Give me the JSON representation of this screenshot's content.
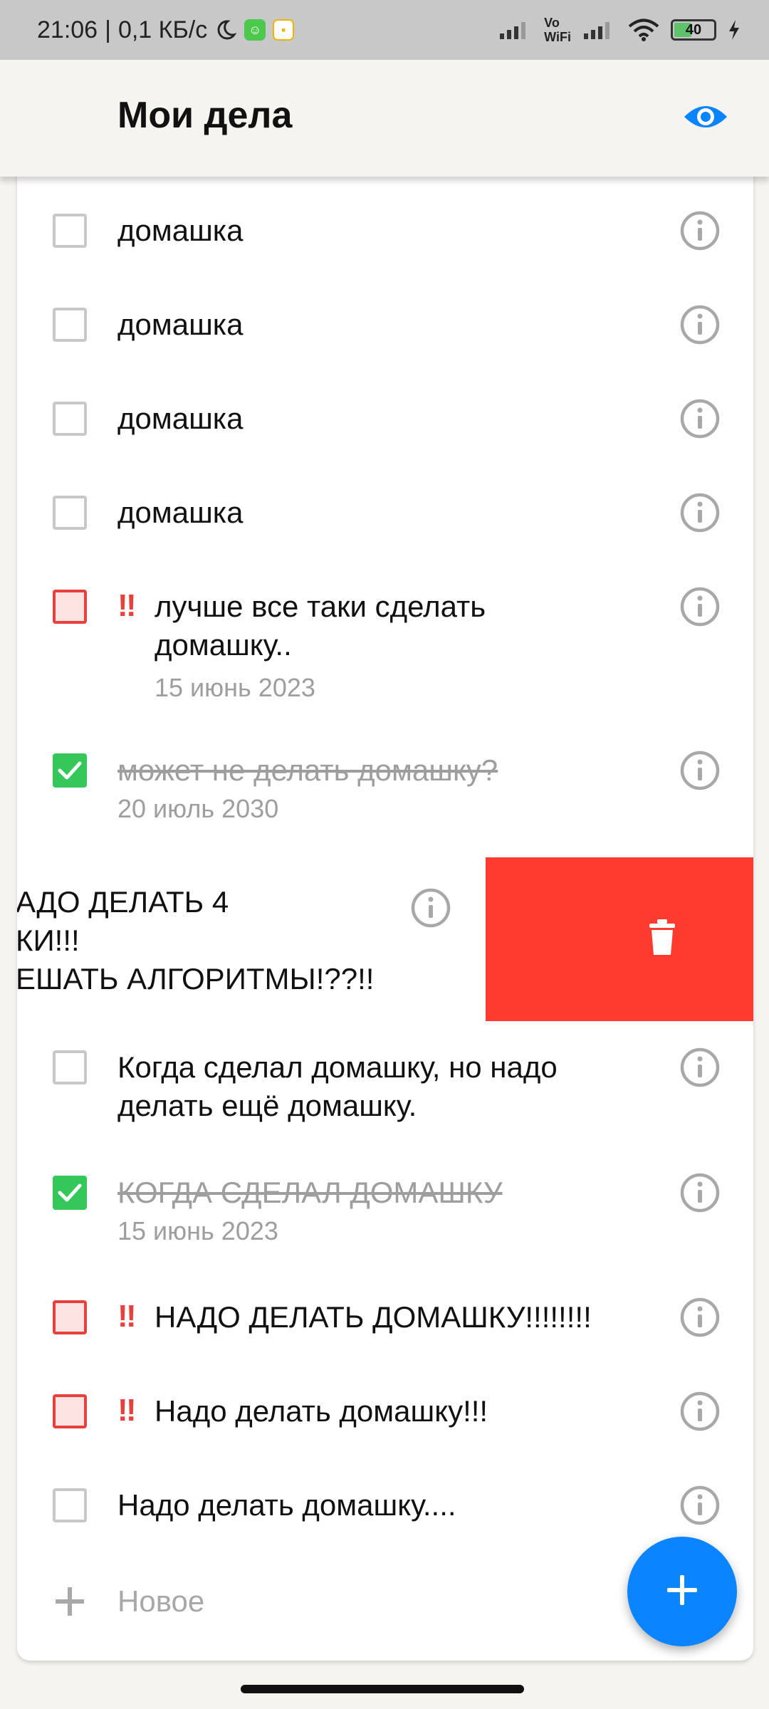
{
  "status_bar": {
    "time": "21:06",
    "separator": "|",
    "speed": "0,1 КБ/с",
    "volte": "Vo",
    "wifi_label": "WiFi",
    "battery": "40"
  },
  "header": {
    "title": "Мои дела"
  },
  "tasks": [
    {
      "text": "домашка"
    },
    {
      "text": "домашка"
    },
    {
      "text": "домашка"
    },
    {
      "text": "домашка"
    },
    {
      "priority": "‼",
      "text": "лучше все таки сделать домашку..",
      "date": "15 июнь 2023"
    },
    {
      "text": "может не делать домашку?",
      "date": "20 июль 2030"
    },
    {
      "text": "АДО ДЕЛАТЬ 4\nКИ!!!\nЕШАТЬ АЛГОРИТМЫ!??!!"
    },
    {
      "text": "Когда сделал домашку, но надо делать ещё домашку."
    },
    {
      "text": "КОГДА СДЕЛАЛ ДОМАШКУ",
      "date": "15 июнь 2023"
    },
    {
      "priority": "‼",
      "text": "НАДО ДЕЛАТЬ ДОМАШКУ!!!!!!!!"
    },
    {
      "priority": "‼",
      "text": "Надо делать домашку!!!"
    },
    {
      "text": "Надо делать домашку...."
    }
  ],
  "new_item": {
    "label": "Новое"
  },
  "colors": {
    "accent": "#0a84ff",
    "done": "#35c759",
    "important": "#e8403a",
    "delete": "#ff3b30"
  }
}
